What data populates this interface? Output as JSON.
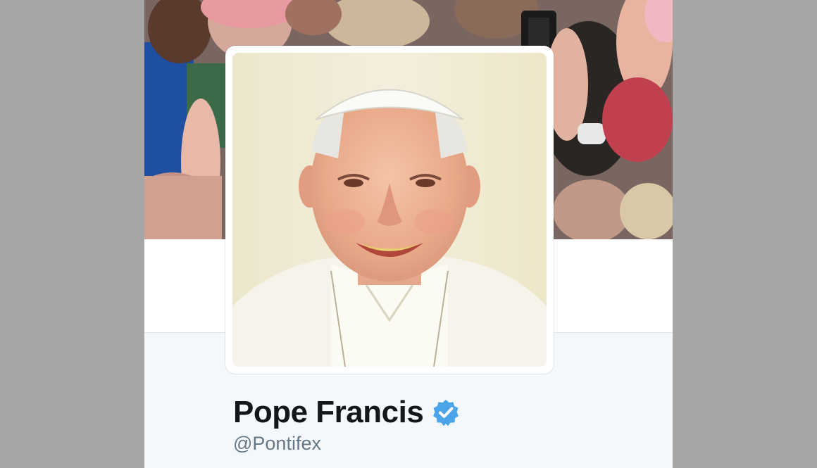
{
  "profile": {
    "display_name": "Pope Francis",
    "screen_name": "@Pontifex",
    "verified": true,
    "verified_icon": "verified-badge-icon",
    "avatar_icon": "profile-avatar-photo",
    "header_icon": "header-banner-photo"
  },
  "colors": {
    "page_background": "#a6a6a6",
    "card_background": "#f5f8fa",
    "name_color": "#14171a",
    "handle_color": "#657786",
    "verified_color": "#4ba4e8"
  }
}
